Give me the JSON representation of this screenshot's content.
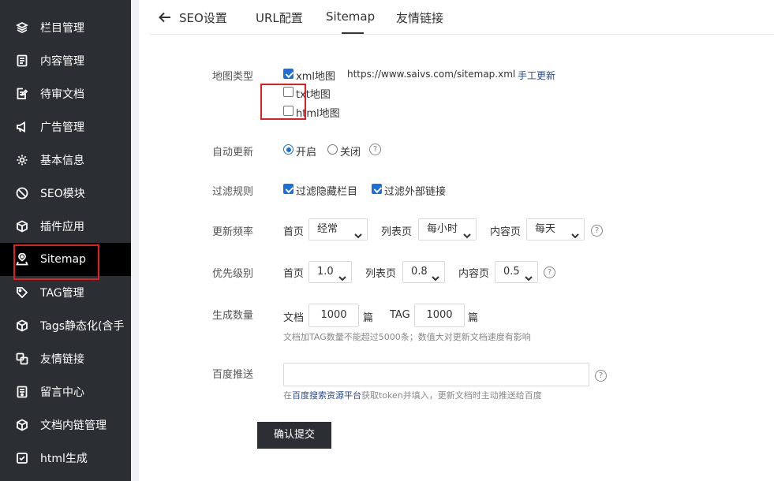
{
  "sidebar": {
    "items": [
      {
        "label": "栏目管理",
        "icon": "layers-icon"
      },
      {
        "label": "内容管理",
        "icon": "document-icon"
      },
      {
        "label": "待审文档",
        "icon": "edit-document-icon"
      },
      {
        "label": "广告管理",
        "icon": "megaphone-icon"
      },
      {
        "label": "基本信息",
        "icon": "gear-icon"
      },
      {
        "label": "SEO模块",
        "icon": "no-entry-icon"
      },
      {
        "label": "插件应用",
        "icon": "cube-icon"
      },
      {
        "label": "Sitemap",
        "icon": "map-pin-icon"
      },
      {
        "label": "TAG管理",
        "icon": "tag-icon"
      },
      {
        "label": "Tags静态化(含手",
        "icon": "cube-icon"
      },
      {
        "label": "友情链接",
        "icon": "link-icon"
      },
      {
        "label": "留言中心",
        "icon": "message-icon"
      },
      {
        "label": "文档内链管理",
        "icon": "cube-icon"
      },
      {
        "label": "html生成",
        "icon": "checkbox-icon"
      }
    ],
    "active_index": 7
  },
  "tabs": [
    {
      "label": "SEO设置"
    },
    {
      "label": "URL配置"
    },
    {
      "label": "Sitemap"
    },
    {
      "label": "友情链接"
    }
  ],
  "form": {
    "map_type": {
      "label": "地图类型",
      "xml_label": "xml地图",
      "xml_checked": true,
      "xml_url": "https://www.saivs.com/sitemap.xml",
      "manual_update": "手工更新",
      "txt_label": "txt地图",
      "txt_checked": false,
      "html_label": "html地图",
      "html_checked": false
    },
    "auto_update": {
      "label": "自动更新",
      "on_label": "开启",
      "off_label": "关闭",
      "selected": "on"
    },
    "filter": {
      "label": "过滤规则",
      "hidden_label": "过滤隐藏栏目",
      "hidden_checked": true,
      "external_label": "过滤外部链接",
      "external_checked": true
    },
    "frequency": {
      "label": "更新频率",
      "home_label": "首页",
      "home_value": "经常",
      "list_label": "列表页",
      "list_value": "每小时",
      "content_label": "内容页",
      "content_value": "每天"
    },
    "priority": {
      "label": "优先级别",
      "home_label": "首页",
      "home_value": "1.0",
      "list_label": "列表页",
      "list_value": "0.8",
      "content_label": "内容页",
      "content_value": "0.5"
    },
    "count": {
      "label": "生成数量",
      "doc_label": "文档",
      "doc_value": "1000",
      "doc_unit": "篇",
      "tag_label": "TAG",
      "tag_value": "1000",
      "tag_unit": "篇",
      "hint": "文档加TAG数量不能超过5000条；数值大对更新文档速度有影响"
    },
    "baidu": {
      "label": "百度推送",
      "value": "",
      "hint_prefix": "在",
      "hint_link": "百度搜索资源平台",
      "hint_suffix": "获取token并填入，更新文档时主动推送给百度"
    },
    "submit_label": "确认提交"
  },
  "colors": {
    "sidebar_bg": "#2b2f33",
    "active_bg": "#000000",
    "accent": "#1a6fd8",
    "link": "#2b4a8b",
    "highlight": "#e02020"
  }
}
